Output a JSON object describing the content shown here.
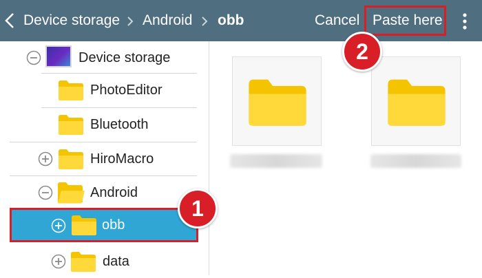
{
  "header": {
    "breadcrumbs": [
      "Device storage",
      "Android",
      "obb"
    ],
    "cancel_label": "Cancel",
    "paste_label": "Paste here",
    "background_color": "#4f6f80"
  },
  "tree": {
    "items": [
      {
        "label": "Device storage",
        "toggle": "collapse",
        "icon": "storage-icon"
      },
      {
        "label": "PhotoEditor",
        "toggle": "none",
        "icon": "folder-icon"
      },
      {
        "label": "Bluetooth",
        "toggle": "none",
        "icon": "folder-icon"
      },
      {
        "label": "HiroMacro",
        "toggle": "expand",
        "icon": "folder-icon"
      },
      {
        "label": "Android",
        "toggle": "collapse",
        "icon": "folder-open-icon"
      },
      {
        "label": "obb",
        "toggle": "expand",
        "icon": "folder-icon",
        "selected": true
      },
      {
        "label": "data",
        "toggle": "expand",
        "icon": "folder-icon"
      }
    ],
    "selected_color": "#2fa6d4"
  },
  "annotations": {
    "step_1": "1",
    "step_2": "2",
    "highlight_color": "#d81e27"
  },
  "content": {
    "folder_count_visible": 2,
    "folder_color": "#ffd23a"
  }
}
